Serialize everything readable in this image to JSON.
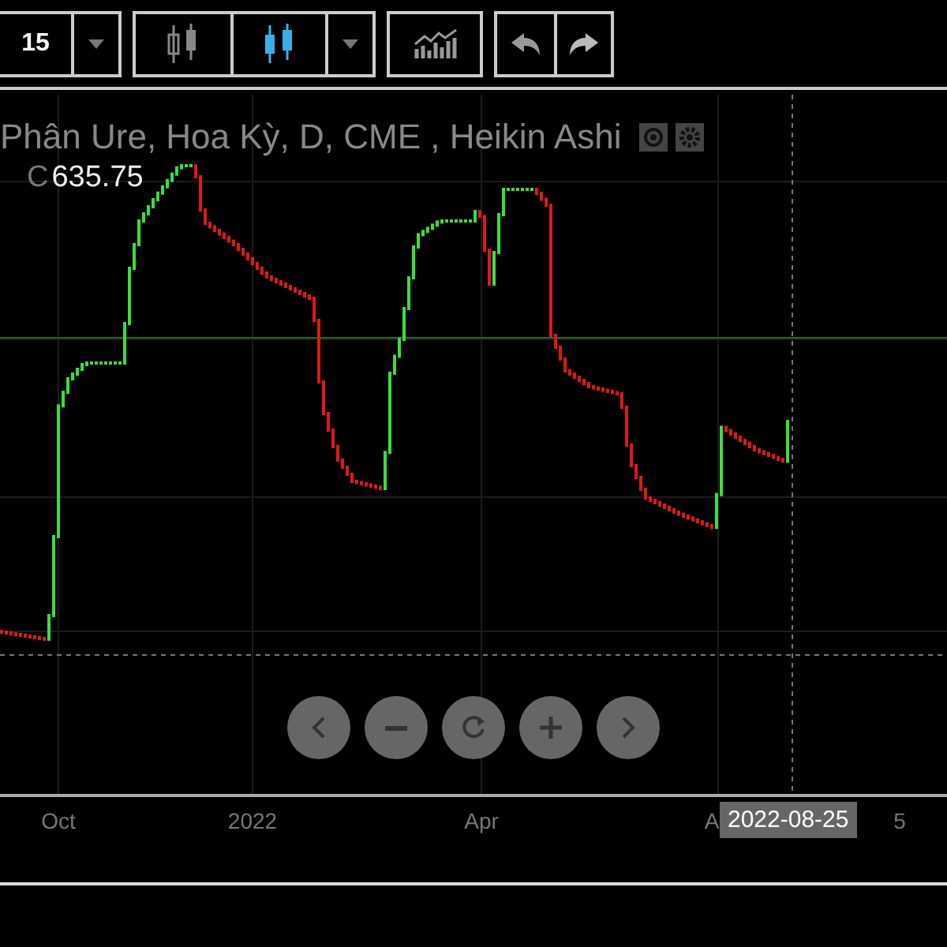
{
  "toolbar": {
    "interval": "15"
  },
  "legend": {
    "title": "Phân Ure, Hoa Kỳ, D, CME , Heikin Ashi",
    "close_label": "C",
    "close_value": "635.75"
  },
  "x_axis": {
    "labels": [
      "Oct",
      "2022",
      "Apr",
      "A",
      "5"
    ]
  },
  "crosshair": {
    "date": "2022-08-25"
  }
}
